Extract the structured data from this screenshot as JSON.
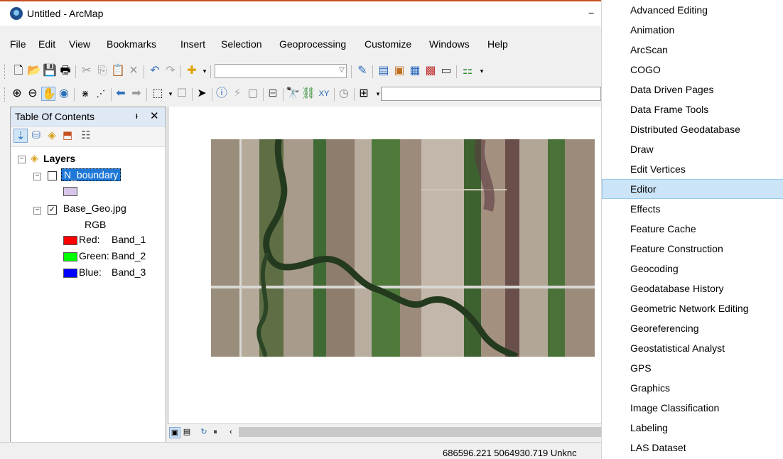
{
  "window": {
    "title": "Untitled - ArcMap",
    "minimize_glyph": "−"
  },
  "menubar": [
    "File",
    "Edit",
    "View",
    "Bookmarks",
    "Insert",
    "Selection",
    "Geoprocessing",
    "Customize",
    "Windows",
    "Help"
  ],
  "toolbar1": {
    "icons": [
      "new-document-icon",
      "open-folder-icon",
      "save-icon",
      "print-icon",
      "cut-icon",
      "copy-icon",
      "paste-icon",
      "delete-icon",
      "undo-icon",
      "redo-icon",
      "add-data-icon",
      "scale-combo",
      "editor-toolbar-icon",
      "table-icon",
      "catalog-icon",
      "search-icon",
      "python-icon",
      "model-builder-icon"
    ],
    "scale_value": ""
  },
  "toolbar2": {
    "icons": [
      "zoom-in-icon",
      "zoom-out-icon",
      "pan-icon",
      "full-extent-icon",
      "fixed-zoom-in-icon",
      "fixed-zoom-out-icon",
      "back-icon",
      "forward-icon",
      "select-features-icon",
      "clear-selection-icon",
      "select-elements-icon",
      "identify-icon",
      "hyperlink-icon",
      "html-popup-icon",
      "measure-icon",
      "find-icon",
      "find-route-icon",
      "go-to-xy-icon",
      "time-slider-icon",
      "magnifier-icon"
    ]
  },
  "toc": {
    "title": "Table Of Contents",
    "pin_glyph": "ᵻ",
    "close_glyph": "✕",
    "layers_label": "Layers",
    "layer1": {
      "name": "N_boundary",
      "checked": false,
      "swatch_color": "#d8c6e8"
    },
    "layer2": {
      "name": "Base_Geo.jpg",
      "checked": true,
      "rgb_label": "RGB",
      "bands": [
        {
          "label": "Red:",
          "band": "Band_1",
          "color": "#ff0000"
        },
        {
          "label": "Green:",
          "band": "Band_2",
          "color": "#00ff00"
        },
        {
          "label": "Blue:",
          "band": "Band_3",
          "color": "#0000ff"
        }
      ]
    }
  },
  "status": {
    "coordinates": "686596.221  5064930.719 Unknc"
  },
  "dropdown_menu": {
    "items": [
      "Advanced Editing",
      "Animation",
      "ArcScan",
      "COGO",
      "Data Driven Pages",
      "Data Frame Tools",
      "Distributed Geodatabase",
      "Draw",
      "Edit Vertices",
      "Editor",
      "Effects",
      "Feature Cache",
      "Feature Construction",
      "Geocoding",
      "Geodatabase History",
      "Geometric Network Editing",
      "Georeferencing",
      "Geostatistical Analyst",
      "GPS",
      "Graphics",
      "Image Classification",
      "Labeling",
      "LAS Dataset"
    ],
    "selected": "Editor"
  }
}
